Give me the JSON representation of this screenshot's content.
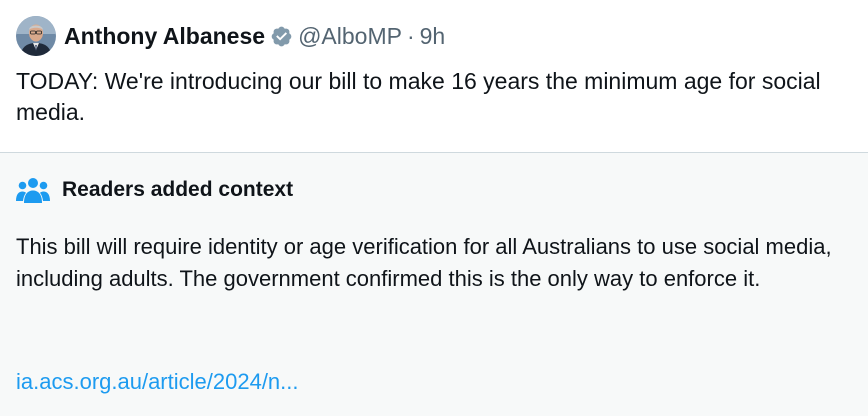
{
  "tweet": {
    "display_name": "Anthony Albanese",
    "handle": "@AlboMP",
    "separator": "·",
    "time": "9h",
    "text": "TODAY: We're introducing our bill to make 16 years the minimum age for social media.",
    "verified_icon": "verified-badge-icon",
    "avatar_icon": "profile-photo"
  },
  "context": {
    "icon": "people-icon",
    "title": "Readers added context",
    "body": "This bill will require identity or age verification for all Australians to use social media, including adults. The government confirmed this is the only way to enforce it.",
    "link": "ia.acs.org.au/article/2024/n..."
  },
  "colors": {
    "text": "#0f1419",
    "secondary": "#536471",
    "link": "#1d9bf0",
    "context_bg": "#f7f9f9",
    "divider": "#cfd9de",
    "verified": "#829aab"
  }
}
